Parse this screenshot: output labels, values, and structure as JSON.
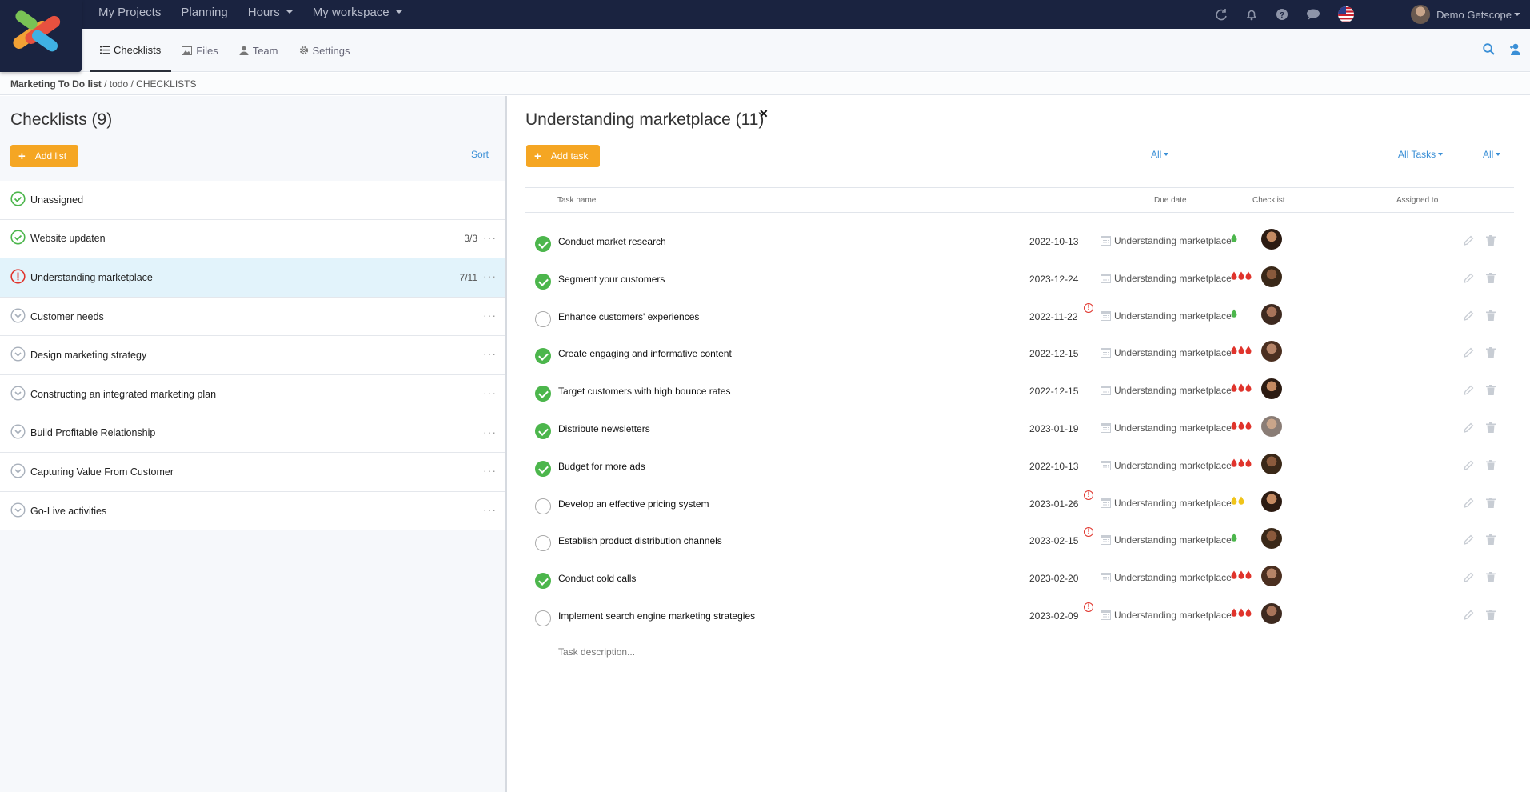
{
  "topnav": {
    "my_projects": "My Projects",
    "planning": "Planning",
    "hours": "Hours",
    "workspace": "My workspace"
  },
  "user": {
    "name": "Demo Getscope"
  },
  "tabs": {
    "checklists": "Checklists",
    "files": "Files",
    "team": "Team",
    "settings": "Settings"
  },
  "breadcrumb": {
    "project": "Marketing To Do list",
    "rest": " / todo / CHECKLISTS"
  },
  "left": {
    "title": "Checklists (9)",
    "add_list": "Add list",
    "sort": "Sort",
    "items": [
      {
        "label": "Unassigned",
        "count": "",
        "status": "ok"
      },
      {
        "label": "Website updaten",
        "count": "3/3",
        "status": "ok"
      },
      {
        "label": "Understanding marketplace",
        "count": "7/11",
        "status": "alert"
      },
      {
        "label": "Customer needs",
        "count": "",
        "status": "collapsed"
      },
      {
        "label": "Design marketing strategy",
        "count": "",
        "status": "collapsed"
      },
      {
        "label": "Constructing an integrated marketing plan",
        "count": "",
        "status": "collapsed"
      },
      {
        "label": "Build Profitable Relationship",
        "count": "",
        "status": "collapsed"
      },
      {
        "label": "Capturing Value From Customer",
        "count": "",
        "status": "collapsed"
      },
      {
        "label": "Go-Live activities",
        "count": "",
        "status": "collapsed"
      }
    ]
  },
  "right": {
    "title": "Understanding marketplace (11)",
    "add_task": "Add task",
    "filters": {
      "f1": "All",
      "f2": "All Tasks",
      "f3": "All"
    },
    "headers": {
      "task_name": "Task name",
      "due_date": "Due date",
      "checklist": "Checklist",
      "assigned_to": "Assigned to"
    },
    "task_desc_placeholder": "Task description...",
    "tasks": [
      {
        "name": "Conduct market research",
        "date": "2022-10-13",
        "done": true,
        "overdue": false,
        "checklist": "Understanding marketplace",
        "priority": "low"
      },
      {
        "name": "Segment your customers",
        "date": "2023-12-24",
        "done": true,
        "overdue": false,
        "checklist": "Understanding marketplace",
        "priority": "high"
      },
      {
        "name": "Enhance customers' experiences",
        "date": "2022-11-22",
        "done": false,
        "overdue": true,
        "checklist": "Understanding marketplace",
        "priority": "low"
      },
      {
        "name": "Create engaging and informative content",
        "date": "2022-12-15",
        "done": true,
        "overdue": false,
        "checklist": "Understanding marketplace",
        "priority": "high"
      },
      {
        "name": "Target customers with high bounce rates",
        "date": "2022-12-15",
        "done": true,
        "overdue": false,
        "checklist": "Understanding marketplace",
        "priority": "high"
      },
      {
        "name": "Distribute newsletters",
        "date": "2023-01-19",
        "done": true,
        "overdue": false,
        "checklist": "Understanding marketplace",
        "priority": "high"
      },
      {
        "name": "Budget for more ads",
        "date": "2022-10-13",
        "done": true,
        "overdue": false,
        "checklist": "Understanding marketplace",
        "priority": "high"
      },
      {
        "name": "Develop an effective pricing system",
        "date": "2023-01-26",
        "done": false,
        "overdue": true,
        "checklist": "Understanding marketplace",
        "priority": "medium"
      },
      {
        "name": "Establish product distribution channels",
        "date": "2023-02-15",
        "done": false,
        "overdue": true,
        "checklist": "Understanding marketplace",
        "priority": "low"
      },
      {
        "name": "Conduct cold calls",
        "date": "2023-02-20",
        "done": true,
        "overdue": false,
        "checklist": "Understanding marketplace",
        "priority": "high"
      },
      {
        "name": "Implement search engine marketing strategies",
        "date": "2023-02-09",
        "done": false,
        "overdue": true,
        "checklist": "Understanding marketplace",
        "priority": "high"
      }
    ]
  },
  "colors": {
    "nav": "#1a2340",
    "accent": "#f5a623",
    "link": "#3a8fd6",
    "done": "#4cb64c",
    "alert": "#e0342c",
    "selected": "#e2f3fb"
  }
}
